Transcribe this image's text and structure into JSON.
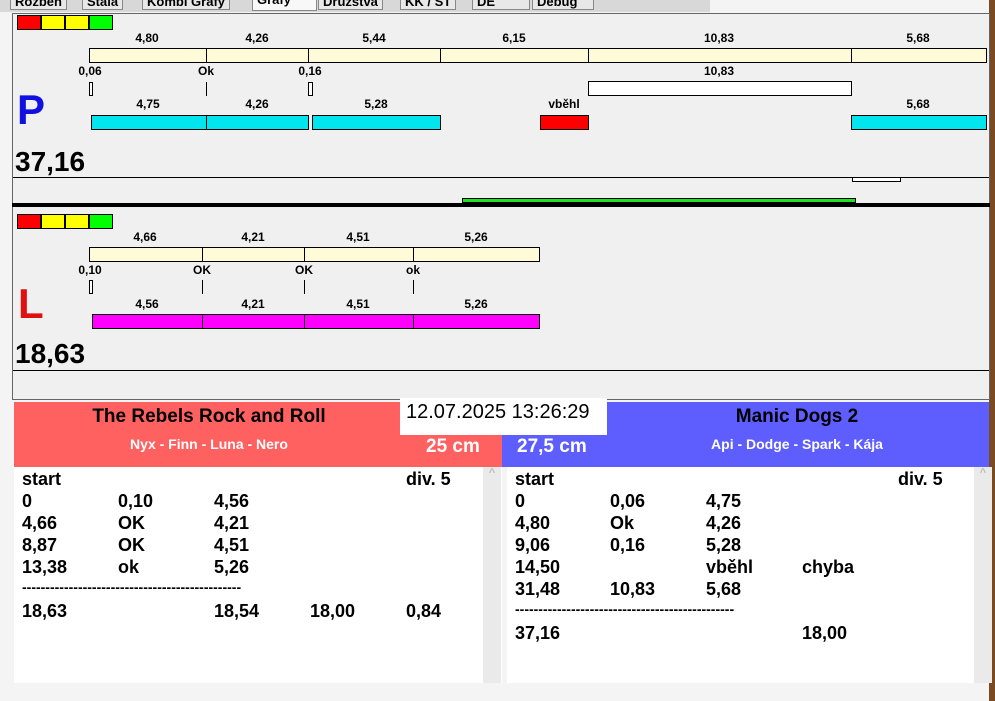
{
  "tabs": [
    "Rozběh",
    "Stála",
    "Kombi Grafy",
    "Grafy",
    "Družstva",
    "KK / ST",
    "DE",
    "Debug"
  ],
  "status_colors": [
    "#ff0000",
    "#ffff00",
    "#ffff00",
    "#00ff00"
  ],
  "right": {
    "letter": "P",
    "total": "37,16",
    "row1": [
      "4,80",
      "4,26",
      "5,44",
      "6,15",
      "10,83",
      "5,68"
    ],
    "row2": [
      "0,06",
      "Ok",
      "0,16",
      "10,83"
    ],
    "row3": [
      "4,75",
      "4,26",
      "5,28",
      "vběhl",
      "5,68"
    ]
  },
  "left": {
    "letter": "L",
    "total": "18,63",
    "row1": [
      "4,66",
      "4,21",
      "4,51",
      "5,26"
    ],
    "row2": [
      "0,10",
      "OK",
      "OK",
      "ok"
    ],
    "row3": [
      "4,56",
      "4,21",
      "4,51",
      "5,26"
    ]
  },
  "datetime": "12.07.2025 13:26:29",
  "team_left": {
    "name": "The Rebels Rock and Roll",
    "dogs": "Nyx - Finn - Luna - Nero",
    "height": "25 cm",
    "header": [
      "start",
      "div.  5"
    ],
    "rows": [
      [
        "0",
        "0,10",
        "4,56",
        ""
      ],
      [
        "4,66",
        "OK",
        "4,21",
        ""
      ],
      [
        "8,87",
        "OK",
        "4,51",
        ""
      ],
      [
        "13,38",
        "ok",
        "5,26",
        ""
      ]
    ],
    "separator": "-----------------------------------------------",
    "summary": [
      "18,63",
      "18,54",
      "18,00",
      "0,84"
    ]
  },
  "team_right": {
    "name": "Manic Dogs 2",
    "dogs": "Api - Dodge - Spark - Kája",
    "height": "27,5 cm",
    "header": [
      "start",
      "div.  5"
    ],
    "rows": [
      [
        "0",
        "0,06",
        "4,75",
        ""
      ],
      [
        "4,80",
        "Ok",
        "4,26",
        ""
      ],
      [
        "9,06",
        "0,16",
        "5,28",
        ""
      ],
      [
        "14,50",
        "",
        "vběhl",
        "chyba"
      ],
      [
        "31,48",
        "10,83",
        "5,68",
        ""
      ]
    ],
    "separator": "-----------------------------------------------",
    "summary": [
      "37,16",
      "18,00"
    ]
  }
}
